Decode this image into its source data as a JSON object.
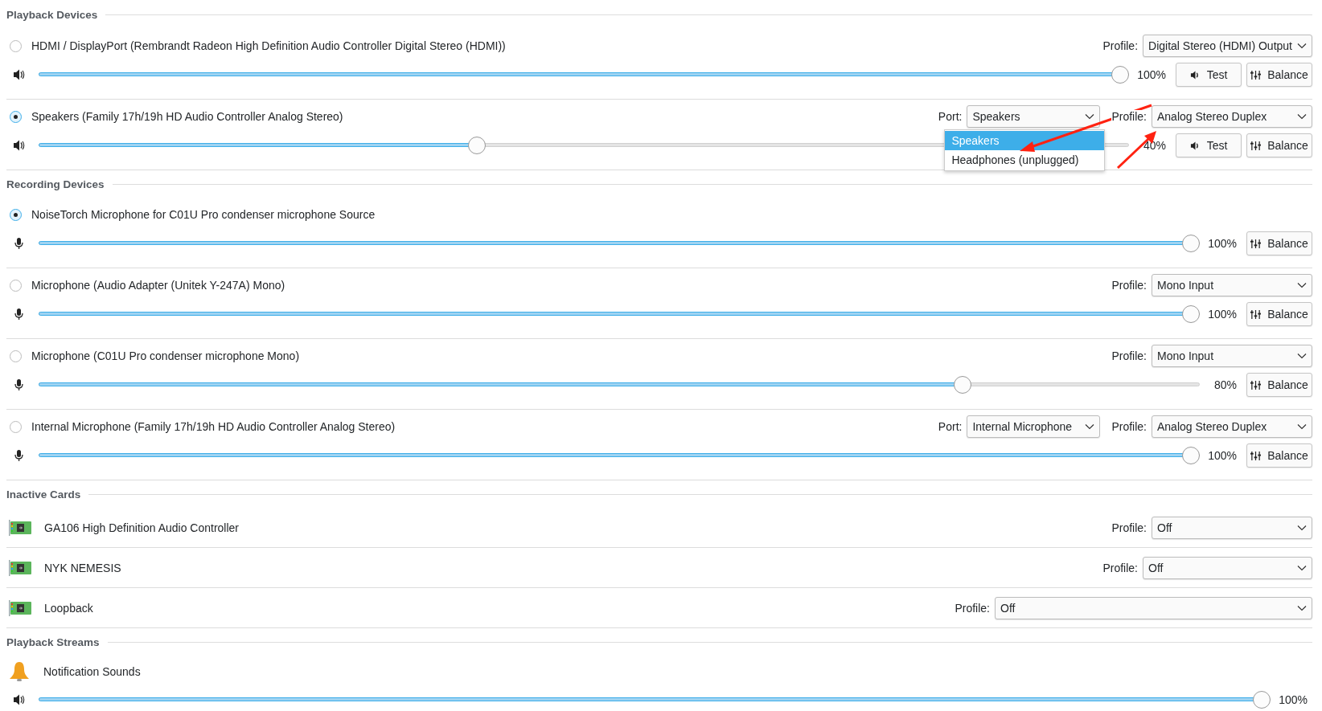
{
  "sections": [
    {
      "title": "Playback Devices",
      "kind": "playback",
      "items": [
        {
          "name": "HDMI / DisplayPort (Rembrandt Radeon High Definition Audio Controller Digital Stereo (HDMI))",
          "selected": false,
          "profile_label": "Profile:",
          "profile": "Digital Stereo (HDMI) Output",
          "level": 1,
          "reading": "100%",
          "buttons": [
            {
              "kind": "test",
              "label": "Test"
            },
            {
              "kind": "balance",
              "label": "Balance"
            }
          ]
        },
        {
          "name": "Speakers (Family 17h/19h HD Audio Controller Analog Stereo)",
          "selected": true,
          "port_label": "Port:",
          "port": {
            "value": "Speakers",
            "options": [
              {
                "label": "Speakers",
                "selected": true
              },
              {
                "label": "Headphones (unplugged)",
                "selected": false
              }
            ]
          },
          "profile_label": "Profile:",
          "profile": "Analog Stereo Duplex",
          "level": 0.4,
          "reading": "40%",
          "buttons": [
            {
              "kind": "test",
              "label": "Test"
            },
            {
              "kind": "balance",
              "label": "Balance"
            }
          ]
        }
      ]
    },
    {
      "title": "Recording Devices",
      "kind": "recording",
      "items": [
        {
          "name": "NoiseTorch Microphone for C01U Pro condenser microphone Source",
          "selected": true,
          "level": 1,
          "reading": "100%",
          "buttons": [
            {
              "kind": "balance",
              "label": "Balance"
            }
          ]
        },
        {
          "name": "Microphone (Audio Adapter (Unitek Y-247A) Mono)",
          "selected": false,
          "profile_label": "Profile:",
          "profile": "Mono Input",
          "level": 1,
          "reading": "100%",
          "buttons": [
            {
              "kind": "balance",
              "label": "Balance"
            }
          ]
        },
        {
          "name": "Microphone (C01U Pro condenser microphone Mono)",
          "selected": false,
          "profile_label": "Profile:",
          "profile": "Mono Input",
          "level": 0.8,
          "reading": "80%",
          "buttons": [
            {
              "kind": "balance",
              "label": "Balance"
            }
          ]
        },
        {
          "name": "Internal Microphone (Family 17h/19h HD Audio Controller Analog Stereo)",
          "selected": false,
          "port_label": "Port:",
          "port": {
            "value": "Internal Microphone"
          },
          "profile_label": "Profile:",
          "profile": "Analog Stereo Duplex",
          "level": 1,
          "reading": "100%",
          "buttons": [
            {
              "kind": "balance",
              "label": "Balance"
            }
          ]
        }
      ]
    },
    {
      "title": "Inactive Cards",
      "kind": "cards",
      "items": [
        {
          "name": "GA106 High Definition Audio Controller",
          "profile_label": "Profile:",
          "profile": "Off"
        },
        {
          "name": "NYK NEMESIS",
          "profile_label": "Profile:",
          "profile": "Off"
        },
        {
          "name": "Loopback",
          "profile_label": "Profile:",
          "profile": "Off"
        }
      ]
    },
    {
      "title": "Playback Streams",
      "kind": "streams",
      "items": [
        {
          "name": "Notification Sounds",
          "level": 1,
          "reading": "100%"
        }
      ]
    }
  ]
}
